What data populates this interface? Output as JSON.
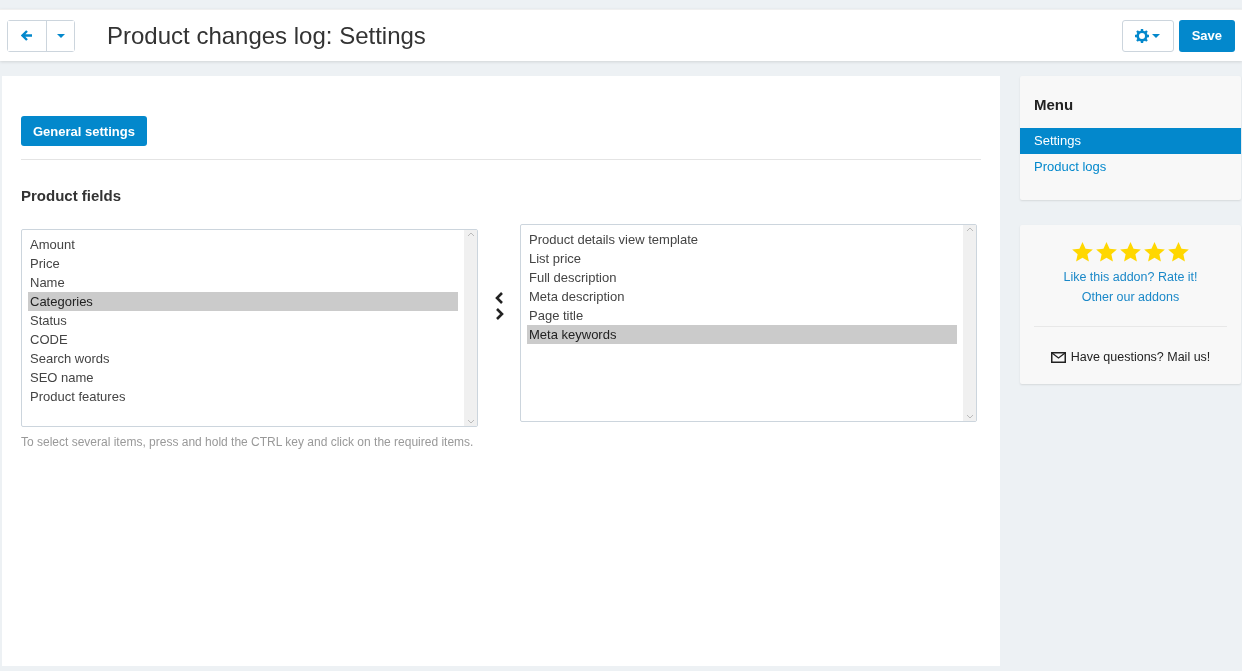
{
  "header": {
    "title": "Product changes log: Settings",
    "save": "Save"
  },
  "tabs": [
    {
      "label": "General settings",
      "selected": true
    }
  ],
  "section": {
    "title": "Product fields"
  },
  "available": [
    {
      "label": "Amount",
      "selected": false
    },
    {
      "label": "Price",
      "selected": false
    },
    {
      "label": "Name",
      "selected": false
    },
    {
      "label": "Categories",
      "selected": true
    },
    {
      "label": "Status",
      "selected": false
    },
    {
      "label": "CODE",
      "selected": false
    },
    {
      "label": "Search words",
      "selected": false
    },
    {
      "label": "SEO name",
      "selected": false
    },
    {
      "label": "Product features",
      "selected": false
    }
  ],
  "chosen": [
    {
      "label": "Product details view template",
      "selected": false
    },
    {
      "label": "List price",
      "selected": false
    },
    {
      "label": "Full description",
      "selected": false
    },
    {
      "label": "Meta description",
      "selected": false
    },
    {
      "label": "Page title",
      "selected": false
    },
    {
      "label": "Meta keywords",
      "selected": true
    }
  ],
  "hint": "To select several items, press and hold the CTRL key and click on the required items.",
  "sidebar": {
    "title": "Menu",
    "items": [
      {
        "label": "Settings",
        "selected": true
      },
      {
        "label": "Product logs",
        "selected": false
      }
    ]
  },
  "promo": {
    "stars": 5,
    "rate": "Like this addon? Rate it!",
    "other": "Other our addons",
    "mail": "Have questions? Mail us!"
  }
}
